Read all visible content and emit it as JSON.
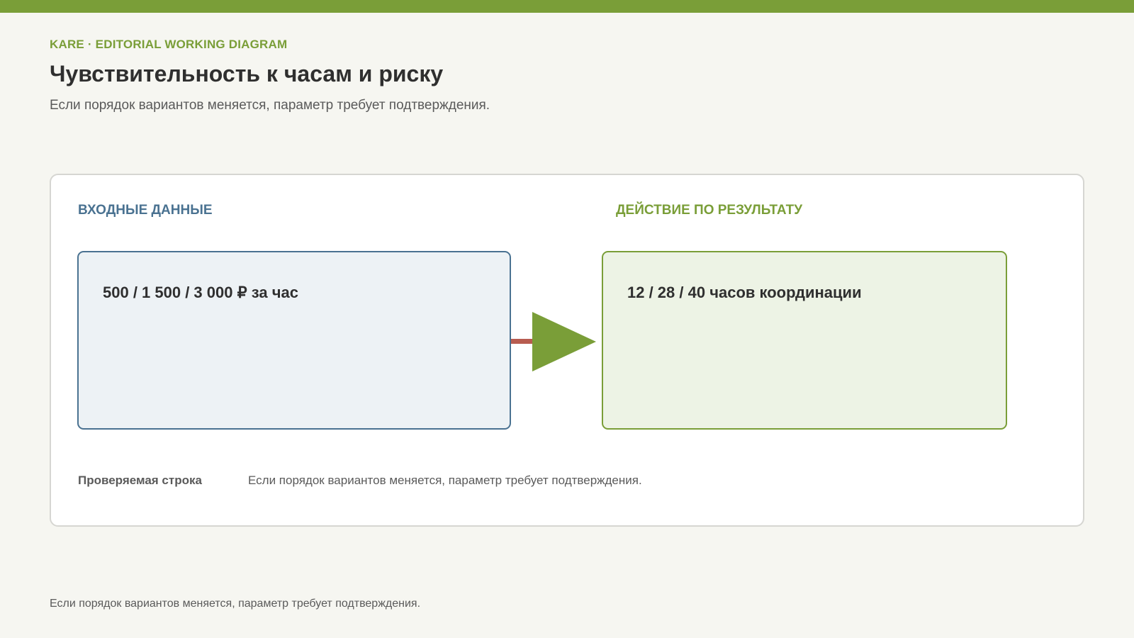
{
  "header": {
    "eyebrow": "KARE · EDITORIAL WORKING DIAGRAM",
    "title": "Чувствительность к часам и риску",
    "subtitle": "Если порядок вариантов меняется, параметр требует подтверждения."
  },
  "diagram": {
    "input": {
      "heading": "ВХОДНЫЕ ДАННЫЕ",
      "value": "500 / 1 500 / 3 000 ₽ за час"
    },
    "output": {
      "heading": "ДЕЙСТВИЕ ПО РЕЗУЛЬТАТУ",
      "value": "12 / 28 / 40 часов координации"
    },
    "check_row": {
      "label": "Проверяемая строка",
      "text": "Если порядок вариантов меняется, параметр требует подтверждения."
    }
  },
  "footer": {
    "note": "Если порядок вариантов меняется, параметр требует подтверждения."
  },
  "colors": {
    "accent_green": "#7a9e38",
    "accent_blue": "#4a7291",
    "connector_red": "#b85c50",
    "background": "#f6f6f1"
  }
}
